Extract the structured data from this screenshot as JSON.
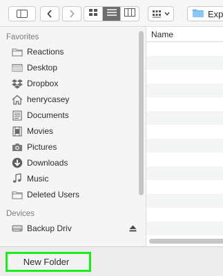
{
  "toolbar": {
    "sidebar_toggle_icon": "sidebar-toggle-icon",
    "back_icon": "chevron-left-icon",
    "forward_icon": "chevron-right-icon",
    "view_modes": [
      "icon-view",
      "list-view",
      "column-view"
    ],
    "active_view": "list-view",
    "arrange_icon": "grid-icon",
    "path": {
      "icon": "folder-icon",
      "label": "Expo"
    }
  },
  "sidebar": {
    "favorites_header": "Favorites",
    "favorites": [
      {
        "label": "Reactions",
        "icon": "folder-icon"
      },
      {
        "label": "Desktop",
        "icon": "desktop-icon"
      },
      {
        "label": "Dropbox",
        "icon": "dropbox-icon"
      },
      {
        "label": "henrycasey",
        "icon": "home-icon"
      },
      {
        "label": "Documents",
        "icon": "documents-icon"
      },
      {
        "label": "Movies",
        "icon": "movies-icon"
      },
      {
        "label": "Pictures",
        "icon": "camera-icon"
      },
      {
        "label": "Downloads",
        "icon": "download-icon"
      },
      {
        "label": "Music",
        "icon": "music-icon"
      },
      {
        "label": "Deleted Users",
        "icon": "folder-icon"
      }
    ],
    "devices_header": "Devices",
    "devices": [
      {
        "label": "Backup Driv",
        "icon": "drive-icon",
        "eject_icon": "eject-icon"
      }
    ]
  },
  "filelist": {
    "column_name": "Name"
  },
  "bottom": {
    "new_folder_label": "New Folder",
    "highlight_color": "#17ee17"
  }
}
